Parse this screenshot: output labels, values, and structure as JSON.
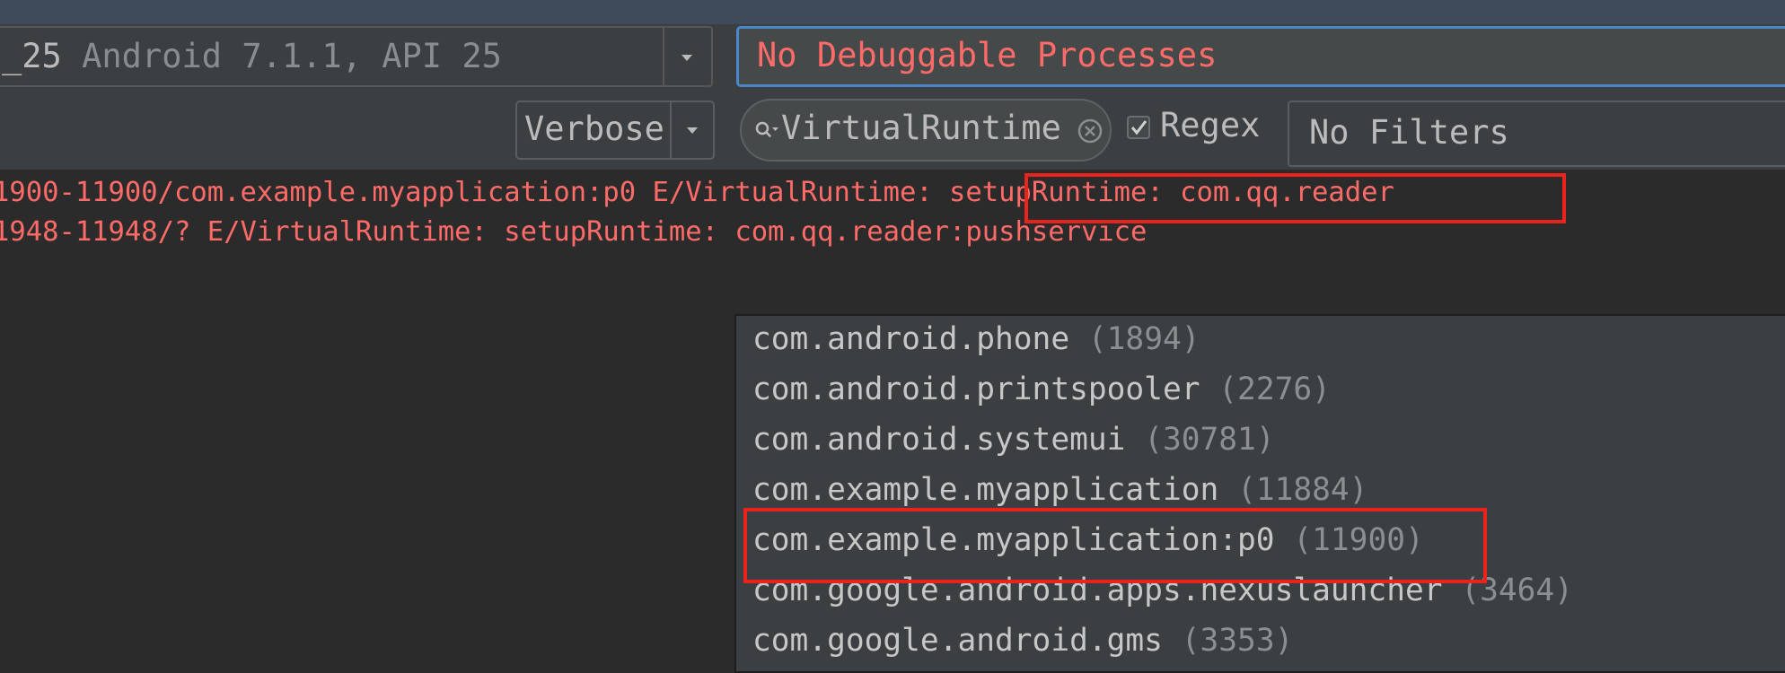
{
  "device_selector": {
    "device_name": "_25",
    "device_info": "Android 7.1.1, API 25",
    "arrow_icon": "triangle-down-icon"
  },
  "process_selector": {
    "text": "No Debuggable Processes",
    "color": "#ff6b68"
  },
  "log_level": {
    "selected": "Verbose",
    "arrow_icon": "triangle-down-icon"
  },
  "search": {
    "value": "VirtualRuntime",
    "search_icon": "magnifier-dropdown-icon",
    "clear_icon": "clear-circle-icon"
  },
  "regex": {
    "label": "Regex",
    "checked": true
  },
  "filter_config": {
    "selected": "No Filters"
  },
  "log_lines": [
    {
      "prefix": "1900-11900/com.example.myapplication:p0 E/VirtualRuntime: ",
      "message": "setupRuntime: com.qq.reader"
    },
    {
      "prefix": "1948-11948/? E/VirtualRuntime: ",
      "message": "setupRuntime: com.qq.reader:pushservice"
    }
  ],
  "process_list": [
    {
      "name": "com.android.phone",
      "pid": "(1894)"
    },
    {
      "name": "com.android.printspooler",
      "pid": "(2276)"
    },
    {
      "name": "com.android.systemui",
      "pid": "(30781)"
    },
    {
      "name": "com.example.myapplication",
      "pid": "(11884)"
    },
    {
      "name": "com.example.myapplication:p0",
      "pid": "(11900)"
    },
    {
      "name": "com.google.android.apps.nexuslauncher",
      "pid": "(3464)"
    },
    {
      "name": "com.google.android.gms",
      "pid": "(3353)"
    }
  ],
  "colors": {
    "background": "#2b2b2b",
    "panel": "#3c3f41",
    "error_text": "#ff6b68",
    "highlight": "#e8241c",
    "focus_border": "#4a88c7"
  }
}
